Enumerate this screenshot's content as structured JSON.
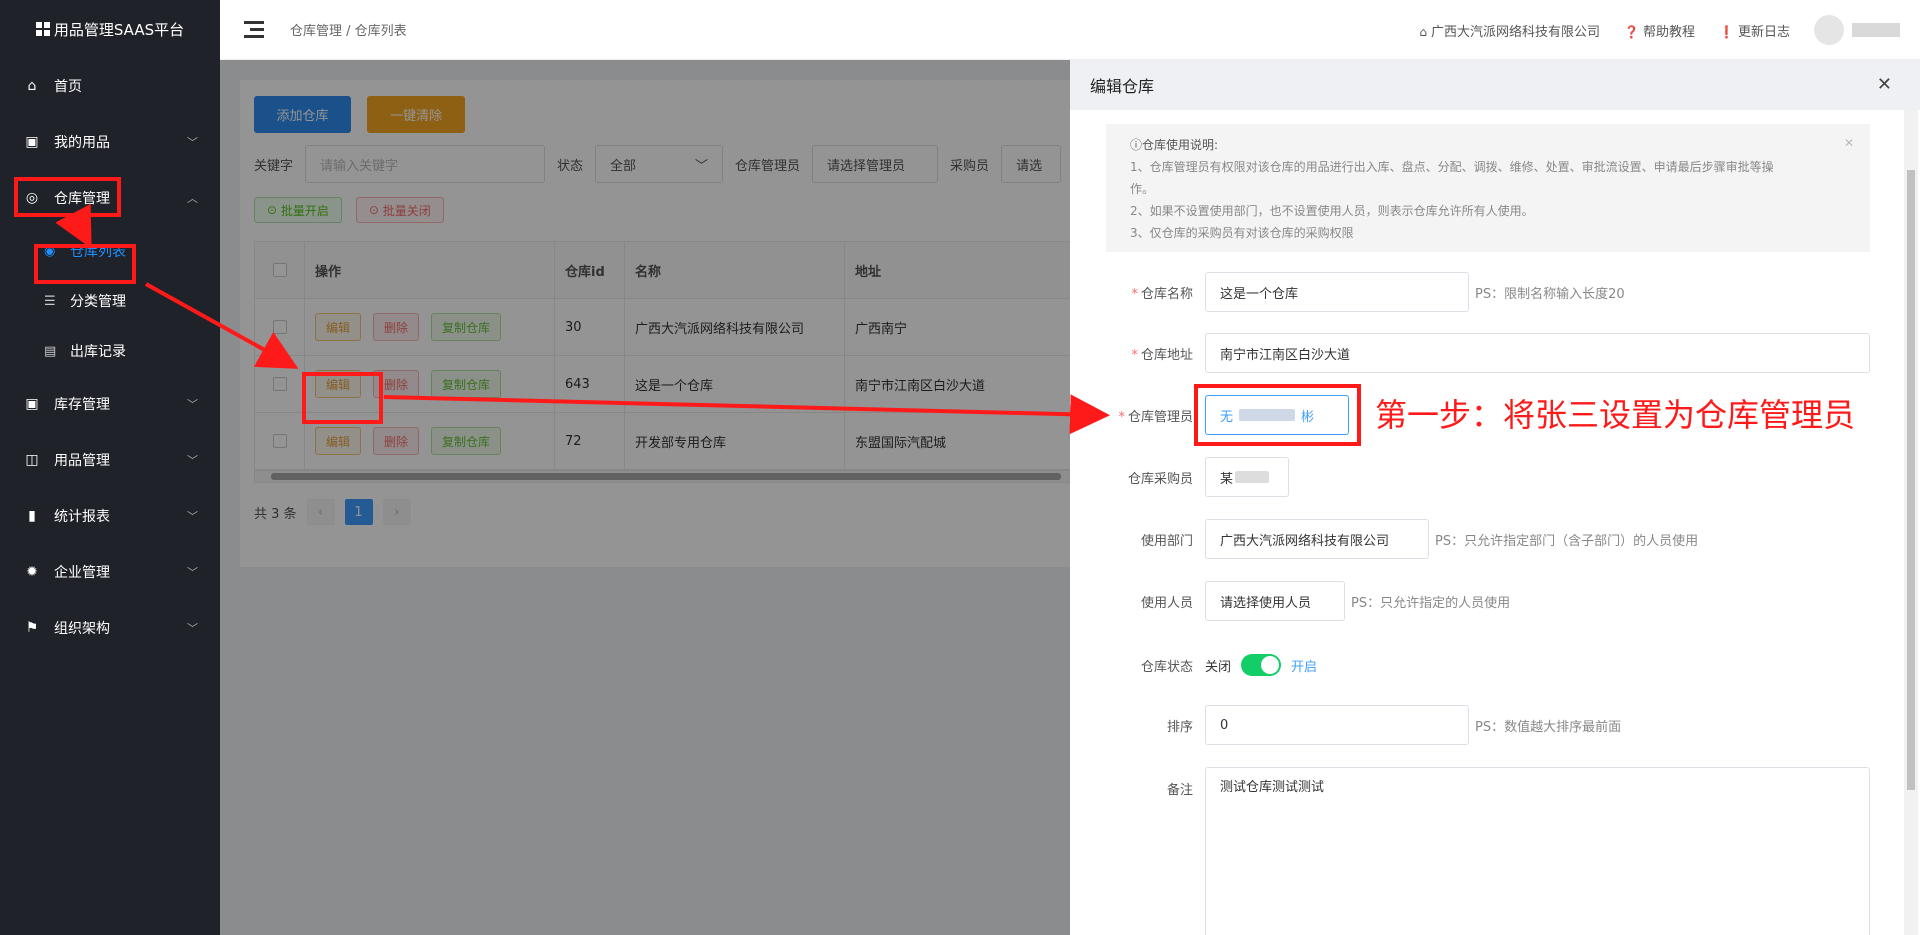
{
  "app": {
    "title": "用品管理SAAS平台"
  },
  "sidebar": {
    "items": [
      {
        "label": "首页",
        "icon": "home-icon"
      },
      {
        "label": "我的用品",
        "icon": "briefcase-icon"
      },
      {
        "label": "仓库管理",
        "icon": "database-icon"
      },
      {
        "label": "库存管理",
        "icon": "briefcase-icon"
      },
      {
        "label": "用品管理",
        "icon": "box-icon"
      },
      {
        "label": "统计报表",
        "icon": "bar-chart-icon"
      },
      {
        "label": "企业管理",
        "icon": "gear-icon"
      },
      {
        "label": "组织架构",
        "icon": "flag-icon"
      }
    ],
    "subitems": [
      {
        "label": "仓库列表",
        "icon": "location-icon"
      },
      {
        "label": "分类管理",
        "icon": "sliders-icon"
      },
      {
        "label": "出库记录",
        "icon": "document-icon"
      }
    ]
  },
  "header": {
    "breadcrumb": "仓库管理 / 仓库列表",
    "company": "广西大汽派网络科技有限公司",
    "help": "帮助教程",
    "changelog": "更新日志"
  },
  "list": {
    "add_button": "添加仓库",
    "clear_button": "一键清除",
    "keyword_label": "关键字",
    "keyword_placeholder": "请输入关键字",
    "status_label": "状态",
    "status_value": "全部",
    "manager_label": "仓库管理员",
    "manager_select": "请选择管理员",
    "buyer_label": "采购员",
    "buyer_select": "请选",
    "batch_open": "批量开启",
    "batch_close": "批量关闭",
    "columns": [
      "操作",
      "仓库id",
      "名称",
      "地址"
    ],
    "row_actions": {
      "edit": "编辑",
      "delete": "删除",
      "copy": "复制仓库"
    },
    "rows": [
      {
        "id": "30",
        "name": "广西大汽派网络科技有限公司",
        "address": "广西南宁"
      },
      {
        "id": "643",
        "name": "这是一个仓库",
        "address": "南宁市江南区白沙大道"
      },
      {
        "id": "72",
        "name": "开发部专用仓库",
        "address": "东盟国际汽配城"
      }
    ],
    "total": "共 3 条",
    "page": "1"
  },
  "drawer": {
    "title": "编辑仓库",
    "notice_title": "仓库使用说明:",
    "notice_lines": [
      "1、仓库管理员有权限对该仓库的用品进行出入库、盘点、分配、调拨、维修、处置、审批流设置、申请最后步骤审批等操",
      "作。",
      "2、如果不设置使用部门，也不设置使用人员，则表示仓库允许所有人使用。",
      "3、仅仓库的采购员有对该仓库的采购权限"
    ],
    "fields": {
      "name_label": "仓库名称",
      "name_value": "这是一个仓库",
      "name_ps": "PS：限制名称输入长度20",
      "address_label": "仓库地址",
      "address_value": "南宁市江南区白沙大道",
      "manager_label": "仓库管理员",
      "manager_value_a": "无",
      "manager_value_b": "彬",
      "buyer_label": "仓库采购员",
      "buyer_value": "某",
      "dept_label": "使用部门",
      "dept_value": "广西大汽派网络科技有限公司",
      "dept_ps": "PS：只允许指定部门（含子部门）的人员使用",
      "user_label": "使用人员",
      "user_value": "请选择使用人员",
      "user_ps": "PS：只允许指定的人员使用",
      "status_label": "仓库状态",
      "status_off": "关闭",
      "status_on": "开启",
      "sort_label": "排序",
      "sort_value": "0",
      "sort_ps": "PS：数值越大排序最前面",
      "remark_label": "备注",
      "remark_value": "测试仓库测试测试"
    }
  },
  "annotation": {
    "text": "第一步：将张三设置为仓库管理员",
    "color": "#ff1a1a"
  }
}
